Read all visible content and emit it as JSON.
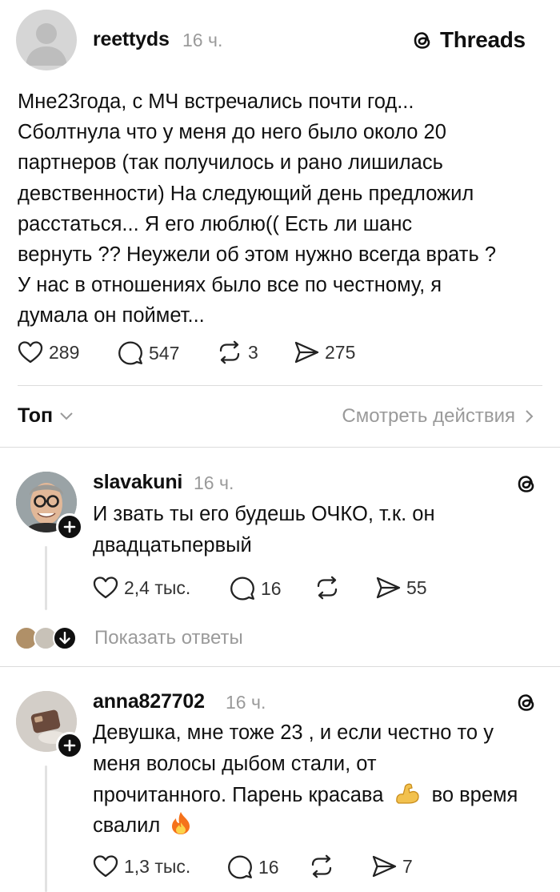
{
  "post": {
    "username": "reettyds",
    "time": "16 ч.",
    "brand": "Threads",
    "text_lines": [
      "Мне23года, с МЧ встречались почти год...",
      "Сболтнула что у меня до него было около 20",
      "партнеров (так получилось и рано лишилась",
      "девственности) На следующий день предложил",
      "расстаться... Я его люблю(( Есть ли шанс",
      "вернуть ?? Неужели об этом нужно всегда врать ?",
      "У нас в отношениях было все по честному, я",
      "думала он поймет..."
    ],
    "likes": "289",
    "comments": "547",
    "reposts": "3",
    "shares": "275"
  },
  "sort": {
    "label": "Топ",
    "view_activity": "Смотреть действия"
  },
  "comments": [
    {
      "username": "slavakuni",
      "time": "16 ч.",
      "text_lines": [
        "И звать ты его будешь ОЧКО, т.к. он",
        "двадцатьпервый"
      ],
      "likes": "2,4 тыс.",
      "replies": "16",
      "shares": "55",
      "show_replies": "Показать ответы"
    },
    {
      "username": "anna827702",
      "time": "16 ч.",
      "line1": "Девушка, мне тоже 23 , и если честно то у",
      "line2": "меня волосы дыбом стали, от",
      "line3a": "прочитанного. Парень красава",
      "line3b": "во время",
      "line4": "свалил",
      "likes": "1,3 тыс.",
      "replies": "16",
      "shares": "7"
    }
  ],
  "colors": {
    "text": "#101010",
    "muted": "#9a9a9a",
    "divider": "#dcdcdc"
  }
}
